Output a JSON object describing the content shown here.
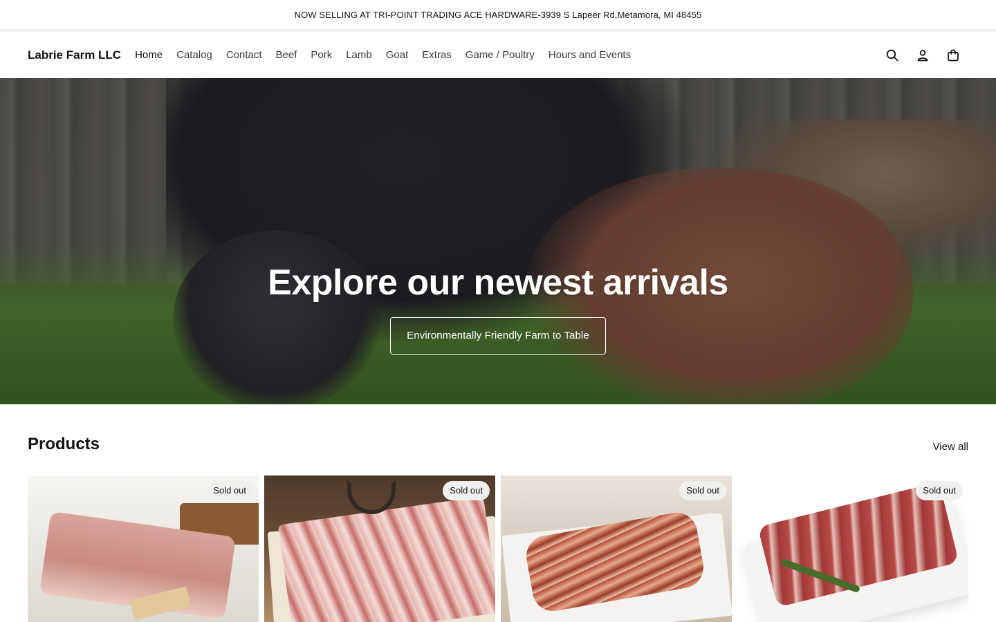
{
  "announcement": {
    "text": "NOW SELLING AT TRI-POINT TRADING ACE HARDWARE-3939 S Lapeer Rd,Metamora, MI 48455"
  },
  "header": {
    "logo": "Labrie Farm LLC",
    "nav": [
      {
        "label": "Home",
        "active": true
      },
      {
        "label": "Catalog"
      },
      {
        "label": "Contact"
      },
      {
        "label": "Beef"
      },
      {
        "label": "Pork"
      },
      {
        "label": "Lamb"
      },
      {
        "label": "Goat"
      },
      {
        "label": "Extras"
      },
      {
        "label": "Game / Poultry"
      },
      {
        "label": "Hours and Events"
      }
    ],
    "icons": [
      "search-icon",
      "account-icon",
      "cart-icon"
    ]
  },
  "hero": {
    "title": "Explore our newest arrivals",
    "button_label": "Environmentally Friendly Farm to Table"
  },
  "products": {
    "title": "Products",
    "view_all": "View all",
    "items": [
      {
        "badge": "Sold out"
      },
      {
        "badge": "Sold out"
      },
      {
        "badge": "Sold out"
      },
      {
        "badge": "Sold out"
      }
    ]
  },
  "colors": {
    "text": "#121212",
    "nav_text": "#3b3b3b",
    "badge_bg": "#f0f0ee",
    "divider": "#efefef"
  }
}
